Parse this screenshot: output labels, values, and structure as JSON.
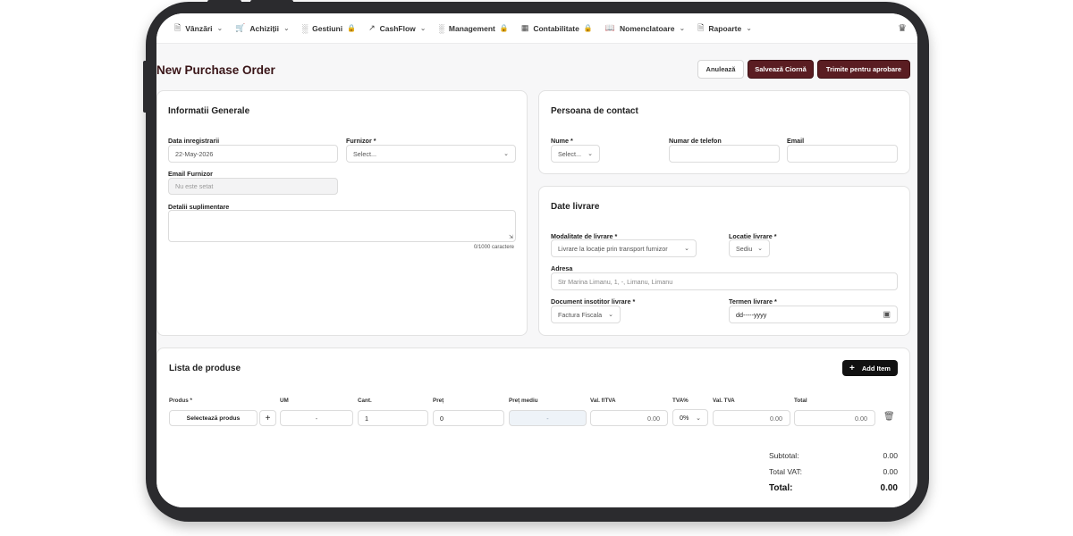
{
  "nav": {
    "items": [
      {
        "label": "Vânzări",
        "icon": "document-icon",
        "suffix": "chevron"
      },
      {
        "label": "Achiziții",
        "icon": "cart-icon",
        "suffix": "chevron"
      },
      {
        "label": "Gestiuni",
        "icon": "chart-icon",
        "suffix": "lock"
      },
      {
        "label": "CashFlow",
        "icon": "trend-icon",
        "suffix": "chevron"
      },
      {
        "label": "Management",
        "icon": "chart-icon",
        "suffix": "lock"
      },
      {
        "label": "Contabilitate",
        "icon": "calculator-icon",
        "suffix": "lock"
      },
      {
        "label": "Nomenclatoare",
        "icon": "book-icon",
        "suffix": "chevron"
      },
      {
        "label": "Rapoarte",
        "icon": "document-icon",
        "suffix": "chevron"
      }
    ]
  },
  "page": {
    "title": "New Purchase Order",
    "cancel_label": "Anulează",
    "save_draft_label": "Salvează Ciornă",
    "submit_label": "Trimite pentru aprobare"
  },
  "general": {
    "title": "Informatii Generale",
    "date_label": "Data inregistrarii",
    "date_value": "22-May-2026",
    "supplier_label": "Furnizor *",
    "supplier_value": "Select...",
    "email_label": "Email Furnizor",
    "email_value": "Nu este setat",
    "details_label": "Detalii suplimentare",
    "char_count": "0/1000 caractere"
  },
  "contact": {
    "title": "Persoana de contact",
    "name_label": "Nume *",
    "name_value": "Select...",
    "phone_label": "Numar de telefon",
    "email_label": "Email"
  },
  "delivery": {
    "title": "Date livrare",
    "mode_label": "Modalitate de livrare *",
    "mode_value": "Livrare la locație prin transport furnizor",
    "location_label": "Locatie livrare *",
    "location_value": "Sediu",
    "address_label": "Adresa",
    "address_value": "Str Marina Limanu, 1, -, Limanu, Limanu",
    "doc_label": "Document insotitor livrare *",
    "doc_value": "Factura Fiscala",
    "term_label": "Termen livrare *",
    "term_value": "dd-----yyyy"
  },
  "products": {
    "title": "Lista de produse",
    "add_label": "Add Item",
    "headers": [
      "Produs *",
      "UM",
      "Cant.",
      "Preț",
      "Preț mediu",
      "Val. f/TVA",
      "TVA%",
      "Val. TVA",
      "Total"
    ],
    "row": {
      "product": "Selectează produs",
      "um": "-",
      "qty": "1",
      "price": "0",
      "avg_price": "-",
      "value_no_vat": "0.00",
      "vat_pct": "0%",
      "vat_value": "0.00",
      "total": "0.00"
    }
  },
  "totals": {
    "subtotal_label": "Subtotal:",
    "subtotal_value": "0.00",
    "vat_label": "Total VAT:",
    "vat_value": "0.00",
    "total_label": "Total:",
    "total_value": "0.00"
  },
  "colors": {
    "accent": "#5a1d22",
    "title": "#3a1518"
  }
}
